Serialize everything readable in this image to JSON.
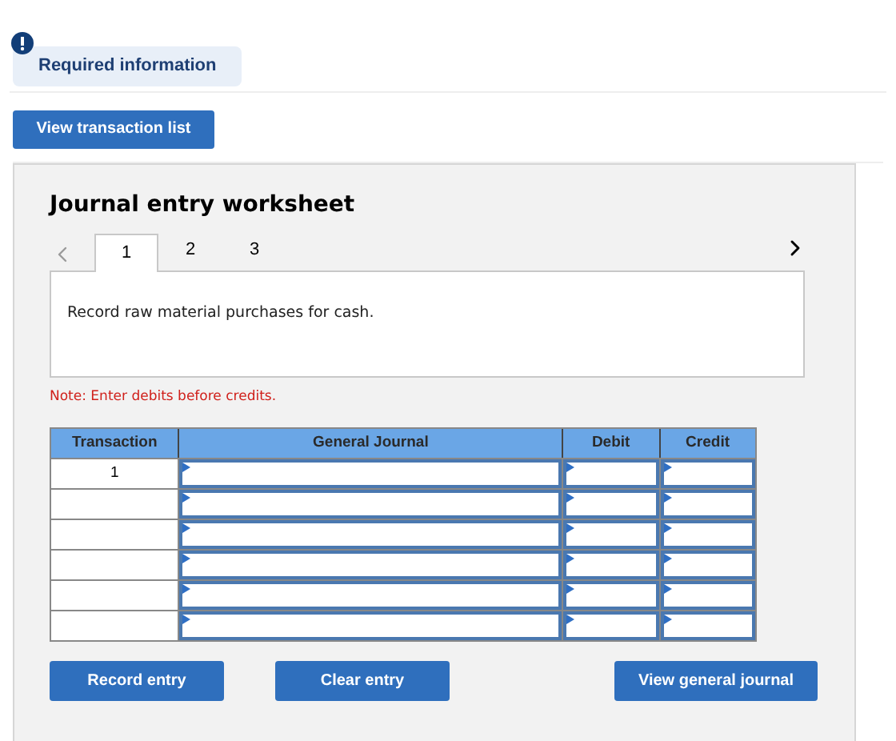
{
  "required_info": {
    "label": "Required information"
  },
  "view_transaction_list": "View transaction list",
  "worksheet": {
    "title": "Journal entry worksheet",
    "tabs": [
      {
        "label": "1",
        "selected": true
      },
      {
        "label": "2",
        "selected": false
      },
      {
        "label": "3",
        "selected": false
      }
    ],
    "prev_disabled": true,
    "description": "Record raw material purchases for cash.",
    "note": "Note: Enter debits before credits.",
    "table": {
      "columns": [
        "Transaction",
        "General Journal",
        "Debit",
        "Credit"
      ],
      "rows": [
        {
          "transaction": "1"
        },
        {},
        {},
        {},
        {},
        {}
      ]
    },
    "buttons": [
      "Record entry",
      "Clear entry",
      "View general journal"
    ]
  }
}
